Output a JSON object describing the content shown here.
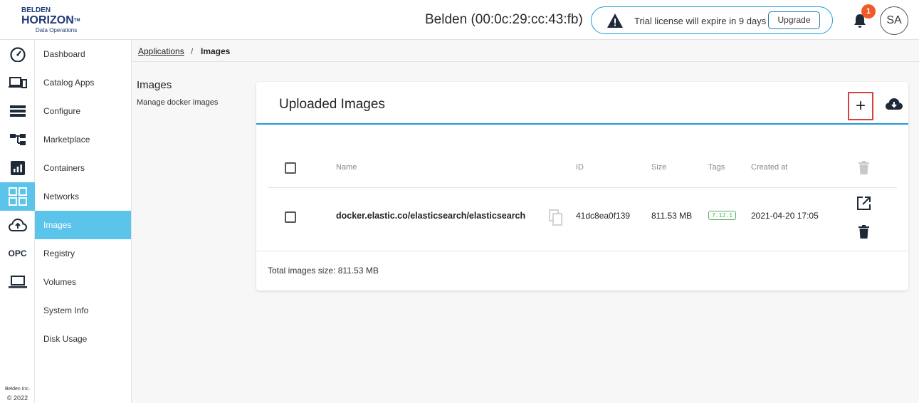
{
  "header": {
    "logo": {
      "line1": "BELDEN",
      "line2": "HORIZON",
      "tm": "TM",
      "line3": "Data Operations"
    },
    "device_title": "Belden (00:0c:29:cc:43:fb)",
    "trial_text": "Trial license will expire in 9 days",
    "upgrade_label": "Upgrade",
    "notification_count": "1",
    "avatar_initials": "SA"
  },
  "rail": {
    "opc_label": "OPC",
    "footer_company": "Belden Inc.",
    "footer_copyright": "© 2022",
    "icons": [
      "dashboard-icon",
      "devices-icon",
      "list-icon",
      "hierarchy-icon",
      "chart-icon",
      "grid-icon",
      "cloud-upload-icon",
      "opc-icon",
      "laptop-icon"
    ]
  },
  "nav": {
    "items": [
      {
        "label": "Dashboard"
      },
      {
        "label": "Catalog Apps"
      },
      {
        "label": "Configure"
      },
      {
        "label": "Marketplace"
      },
      {
        "label": "Containers"
      },
      {
        "label": "Networks"
      },
      {
        "label": "Images"
      },
      {
        "label": "Registry"
      },
      {
        "label": "Volumes"
      },
      {
        "label": "System Info"
      },
      {
        "label": "Disk Usage"
      }
    ],
    "active_index": 6
  },
  "breadcrumb": {
    "parent": "Applications",
    "separator": "/",
    "current": "Images"
  },
  "page": {
    "heading": "Images",
    "subheading": "Manage docker images"
  },
  "card": {
    "title": "Uploaded Images",
    "add_label": "+",
    "columns": {
      "name": "Name",
      "id": "ID",
      "size": "Size",
      "tags": "Tags",
      "created": "Created at"
    },
    "rows": [
      {
        "name": "docker.elastic.co/elasticsearch/elasticsearch",
        "id": "41dc8ea0f139",
        "size": "811.53 MB",
        "tag": "7.12.1",
        "created": "2021-04-20 17:05"
      }
    ],
    "total": "Total images size: 811.53 MB"
  },
  "colors": {
    "accent": "#5bc4eb",
    "primary_line": "#1e9bd7",
    "badge": "#f05a28",
    "tag": "#53b05a",
    "highlight": "#d64040"
  }
}
